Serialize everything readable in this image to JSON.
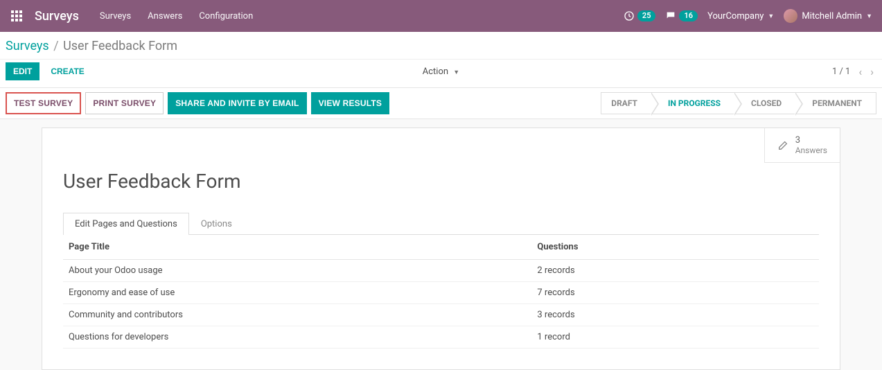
{
  "nav": {
    "brand": "Surveys",
    "links": [
      "Surveys",
      "Answers",
      "Configuration"
    ],
    "clock_badge": "25",
    "chat_badge": "16",
    "company": "YourCompany",
    "user": "Mitchell Admin"
  },
  "breadcrumb": {
    "root": "Surveys",
    "sep": "/",
    "current": "User Feedback Form"
  },
  "buttons": {
    "edit": "Edit",
    "create": "Create",
    "action": "Action"
  },
  "pager": {
    "range": "1 / 1"
  },
  "action_buttons": {
    "test": "TEST SURVEY",
    "print": "PRINT SURVEY",
    "share": "SHARE AND INVITE BY EMAIL",
    "results": "VIEW RESULTS"
  },
  "statusbar": {
    "steps": [
      "DRAFT",
      "IN PROGRESS",
      "CLOSED",
      "PERMANENT"
    ],
    "active_index": 1
  },
  "stat": {
    "answers_count": "3",
    "answers_label": "Answers"
  },
  "record": {
    "title": "User Feedback Form",
    "tabs": {
      "pages": "Edit Pages and Questions",
      "options": "Options"
    },
    "columns": {
      "page_title": "Page Title",
      "questions": "Questions"
    },
    "rows": [
      {
        "title": "About your Odoo usage",
        "questions": "2 records"
      },
      {
        "title": "Ergonomy and ease of use",
        "questions": "7 records"
      },
      {
        "title": "Community and contributors",
        "questions": "3 records"
      },
      {
        "title": "Questions for developers",
        "questions": "1 record"
      }
    ]
  }
}
